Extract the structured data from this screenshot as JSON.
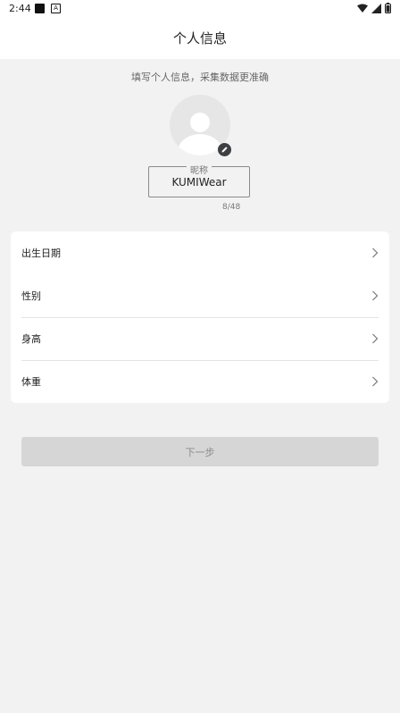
{
  "status_bar": {
    "time": "2:44",
    "a_glyph": "A"
  },
  "header": {
    "title": "个人信息"
  },
  "subtitle": "填写个人信息，采集数据更准确",
  "nickname": {
    "label": "昵称",
    "value": "KUMIWear",
    "count": "8/48"
  },
  "fields": [
    {
      "label": "出生日期"
    },
    {
      "label": "性别"
    },
    {
      "label": "身高"
    },
    {
      "label": "体重"
    }
  ],
  "next_button": {
    "label": "下一步"
  },
  "colors": {
    "background": "#f2f2f2",
    "card": "#ffffff",
    "button_disabled": "#d6d6d6",
    "badge": "#3b3f44"
  }
}
